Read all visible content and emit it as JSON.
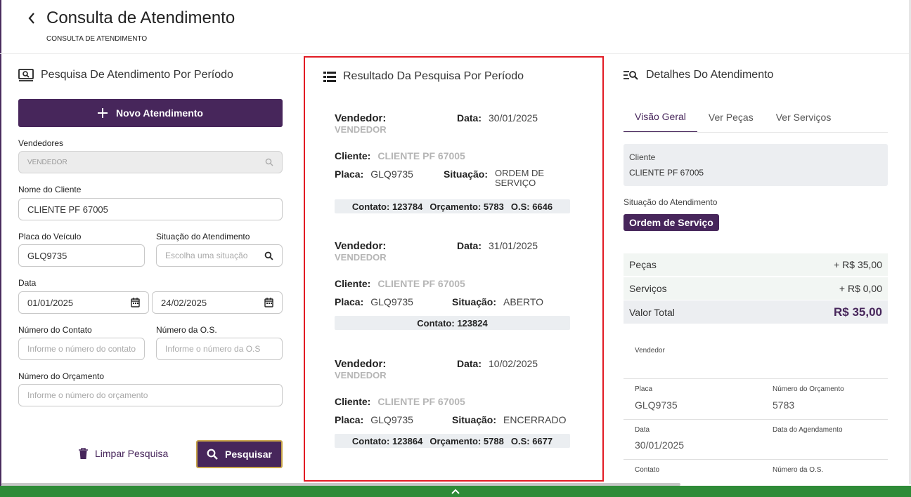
{
  "header": {
    "title": "Consulta de Atendimento",
    "breadcrumb": "CONSULTA DE ATENDIMENTO"
  },
  "search_panel": {
    "title": "Pesquisa De Atendimento Por Período",
    "new_button": "Novo Atendimento",
    "vendedores_label": "Vendedores",
    "vendedores_placeholder": "VENDEDOR",
    "cliente_label": "Nome do Cliente",
    "cliente_value": "CLIENTE PF 67005",
    "placa_label": "Placa do Veículo",
    "placa_value": "GLQ9735",
    "situacao_label": "Situação do Atendimento",
    "situacao_placeholder": "Escolha uma situação",
    "data_label": "Data",
    "data_inicio": "01/01/2025",
    "data_fim": "24/02/2025",
    "contato_label": "Número do Contato",
    "contato_placeholder": "Informe o número do contato",
    "os_label": "Número da O.S.",
    "os_placeholder": "Informe o número da O.S",
    "orcamento_label": "Número do Orçamento",
    "orcamento_placeholder": "Informe o número do orçamento",
    "clear_button": "Limpar Pesquisa",
    "search_button": "Pesquisar"
  },
  "results_panel": {
    "title": "Resultado Da Pesquisa Por Período",
    "labels": {
      "vendedor": "Vendedor:",
      "data": "Data:",
      "cliente": "Cliente:",
      "placa": "Placa:",
      "situacao": "Situação:",
      "contato": "Contato:",
      "orcamento": "Orçamento:",
      "os": "O.S:"
    },
    "items": [
      {
        "vendedor": "VENDEDOR",
        "data": "30/01/2025",
        "cliente": "CLIENTE PF 67005",
        "placa": "GLQ9735",
        "situacao_1": "ORDEM DE",
        "situacao_2": "SERVIÇO",
        "contato": "123784",
        "orcamento": "5783",
        "os": "6646"
      },
      {
        "vendedor": "VENDEDOR",
        "data": "31/01/2025",
        "cliente": "CLIENTE PF 67005",
        "placa": "GLQ9735",
        "situacao": "ABERTO",
        "contato": "123824"
      },
      {
        "vendedor": "VENDEDOR",
        "data": "10/02/2025",
        "cliente": "CLIENTE PF 67005",
        "placa": "GLQ9735",
        "situacao": "ENCERRADO",
        "contato": "123864",
        "orcamento": "5788",
        "os": "6677"
      }
    ]
  },
  "details_panel": {
    "title": "Detalhes Do Atendimento",
    "tabs": [
      "Visão Geral",
      "Ver Peças",
      "Ver Serviços"
    ],
    "cliente_label": "Cliente",
    "cliente_value": "CLIENTE PF 67005",
    "situacao_label": "Situação do Atendimento",
    "situacao_value": "Ordem de Serviço",
    "pecas_label": "Peças",
    "pecas_value": "+ R$ 35,00",
    "servicos_label": "Serviços",
    "servicos_value": "+ R$ 0,00",
    "total_label": "Valor Total",
    "total_value": "R$ 35,00",
    "vendedor_label": "Vendedor",
    "placa_label": "Placa",
    "placa_value": "GLQ9735",
    "orcamento_label": "Número do Orçamento",
    "orcamento_value": "5783",
    "data_label": "Data",
    "data_value": "30/01/2025",
    "agendamento_label": "Data do Agendamento",
    "contato_label": "Contato",
    "os_label": "Número da O.S."
  },
  "colors": {
    "primary": "#47265b",
    "highlight_border": "#e21b24",
    "bottom_bar": "#2e8b37"
  }
}
